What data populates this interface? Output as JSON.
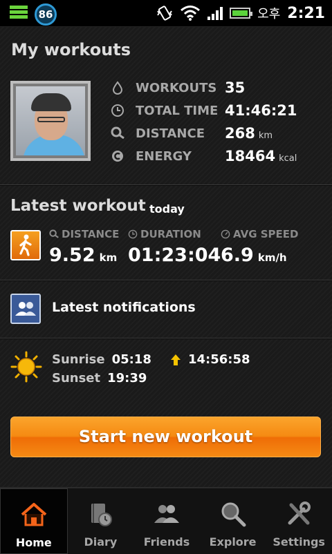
{
  "status_bar": {
    "battery_badge": "86",
    "ampm": "오후",
    "time": "2:21"
  },
  "header": {
    "title": "My workouts"
  },
  "summary": [
    {
      "label": "WORKOUTS",
      "value": "35",
      "unit": ""
    },
    {
      "label": "TOTAL TIME",
      "value": "41:46:21",
      "unit": ""
    },
    {
      "label": "DISTANCE",
      "value": "268",
      "unit": "km"
    },
    {
      "label": "ENERGY",
      "value": "18464",
      "unit": "kcal"
    }
  ],
  "latest": {
    "title": "Latest workout",
    "when": "today",
    "metrics": [
      {
        "label": "DISTANCE",
        "value": "9.52",
        "unit": "km"
      },
      {
        "label": "DURATION",
        "value": "01:23:04",
        "unit": ""
      },
      {
        "label": "AVG SPEED",
        "value": "6.9",
        "unit": "km/h"
      }
    ]
  },
  "notifications": {
    "label": "Latest notifications"
  },
  "sun": {
    "sunrise_label": "Sunrise",
    "sunrise_time": "05:18",
    "sunset_label": "Sunset",
    "sunset_time": "19:39",
    "day_length": "14:56:58"
  },
  "start_button": {
    "label": "Start new workout"
  },
  "tabs": [
    {
      "label": "Home",
      "icon": "home-icon",
      "active": true
    },
    {
      "label": "Diary",
      "icon": "diary-icon",
      "active": false
    },
    {
      "label": "Friends",
      "icon": "friends-icon",
      "active": false
    },
    {
      "label": "Explore",
      "icon": "explore-icon",
      "active": false
    },
    {
      "label": "Settings",
      "icon": "settings-icon",
      "active": false
    }
  ],
  "colors": {
    "accent": "#f58a12",
    "battery": "#5bd23c",
    "badge": "#2e9ad6"
  }
}
